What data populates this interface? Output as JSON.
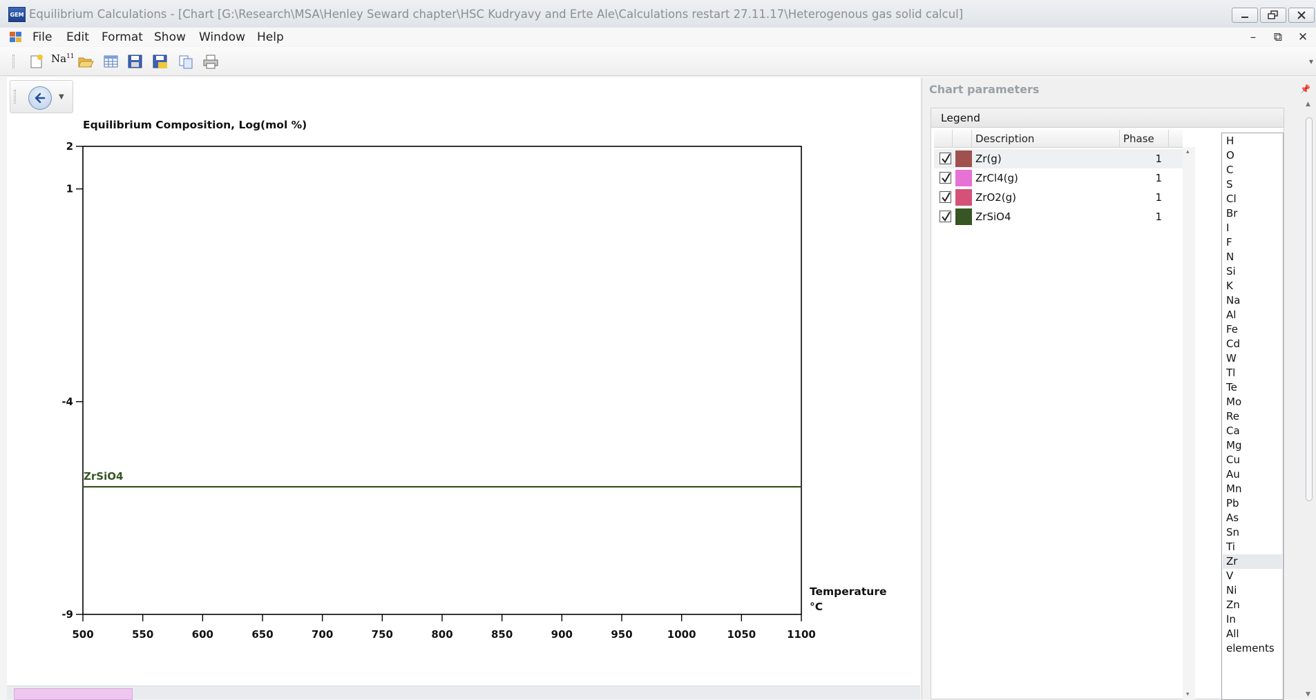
{
  "window": {
    "title": "Equilibrium Calculations - [Chart [G:\\Research\\MSA\\Henley Seward chapter\\HSC Kudryavy and Erte Ale\\Calculations restart 27.11.17\\Heterogenous gas solid calcul]",
    "app_icon_text": "GEM"
  },
  "menu": {
    "items": [
      "File",
      "Edit",
      "Format",
      "Show",
      "Window",
      "Help"
    ],
    "mdi_minimize": "–",
    "mdi_restore": "⧉",
    "mdi_close": "✕"
  },
  "toolbar": {
    "icons": [
      "new-icon",
      "elements-icon",
      "open-folder-icon",
      "table-icon",
      "save-icon",
      "save-as-icon",
      "copy-icon",
      "print-icon"
    ],
    "elements_icon_text": "Na",
    "elements_icon_sup": "11"
  },
  "chart_data": {
    "type": "line",
    "title": "Equilibrium Composition, Log(mol %)",
    "xlabel": "Temperature",
    "xunit": "°C",
    "xlim": [
      500,
      1100
    ],
    "ylim": [
      -9,
      2
    ],
    "x_ticks": [
      "500",
      "550",
      "600",
      "650",
      "700",
      "750",
      "800",
      "850",
      "900",
      "950",
      "1000",
      "1050",
      "1100"
    ],
    "y_ticks": [
      "2",
      "1",
      "-4",
      "-9"
    ],
    "series": [
      {
        "name": "ZrSiO4",
        "color": "#375623",
        "x": [
          500,
          1100
        ],
        "y": [
          -6.0,
          -6.0
        ]
      }
    ]
  },
  "panel": {
    "title": "Chart parameters",
    "legend_tab": "Legend",
    "columns": {
      "description": "Description",
      "phase": "Phase"
    },
    "rows": [
      {
        "description": "Zr(g)",
        "phase": "1",
        "color": "#a0504e",
        "checked": true
      },
      {
        "description": "ZrCl4(g)",
        "phase": "1",
        "color": "#e672d6",
        "checked": true
      },
      {
        "description": "ZrO2(g)",
        "phase": "1",
        "color": "#d4527a",
        "checked": true
      },
      {
        "description": "ZrSiO4",
        "phase": "1",
        "color": "#375623",
        "checked": true
      }
    ],
    "elements": [
      "H",
      "O",
      "C",
      "S",
      "Cl",
      "Br",
      "I",
      "F",
      "N",
      "Si",
      "K",
      "Na",
      "Al",
      "Fe",
      "Cd",
      "W",
      "Tl",
      "Te",
      "Mo",
      "Re",
      "Ca",
      "Mg",
      "Cu",
      "Au",
      "Mn",
      "Pb",
      "As",
      "Sn",
      "Ti",
      "Zr",
      "V",
      "Ni",
      "Zn",
      "In",
      "All elements"
    ],
    "selected_element": "Zr"
  }
}
